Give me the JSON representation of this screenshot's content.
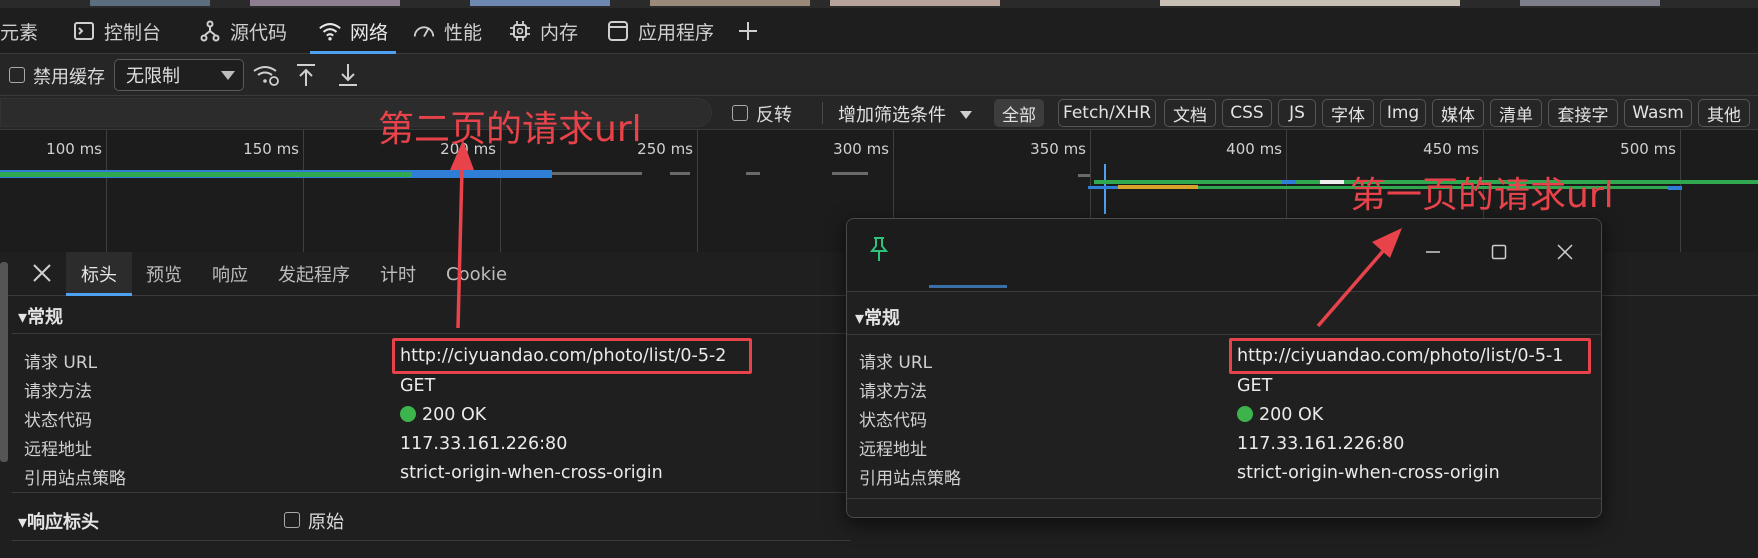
{
  "main_tabs": [
    {
      "label": "元素",
      "icon": "elements-icon"
    },
    {
      "label": "控制台",
      "icon": "console-icon"
    },
    {
      "label": "源代码",
      "icon": "sources-icon"
    },
    {
      "label": "网络",
      "icon": "wifi-icon",
      "active": true
    },
    {
      "label": "性能",
      "icon": "performance-icon"
    },
    {
      "label": "内存",
      "icon": "memory-chip-icon"
    },
    {
      "label": "应用程序",
      "icon": "application-icon"
    }
  ],
  "toolbar": {
    "disable_cache_label": "禁用缓存",
    "throttle_value": "无限制"
  },
  "filter": {
    "invert_label": "反转",
    "more_filters_label": "增加筛选条件",
    "types": [
      "全部",
      "Fetch/XHR",
      "文档",
      "CSS",
      "JS",
      "字体",
      "Img",
      "媒体",
      "清单",
      "套接字",
      "Wasm",
      "其他"
    ]
  },
  "timeline": {
    "ticks": [
      "100 ms",
      "150 ms",
      "200 ms",
      "250 ms",
      "300 ms",
      "350 ms",
      "400 ms",
      "450 ms",
      "500 ms"
    ]
  },
  "detail_tabs": [
    "标头",
    "预览",
    "响应",
    "发起程序",
    "计时",
    "Cookie"
  ],
  "general": {
    "title": "常规",
    "labels": [
      "请求 URL",
      "请求方法",
      "状态代码",
      "远程地址",
      "引用站点策略"
    ],
    "left": {
      "url": "http://ciyuandao.com/photo/list/0-5-2",
      "method": "GET",
      "status": "200 OK",
      "remote": "117.33.161.226:80",
      "referrer_policy": "strict-origin-when-cross-origin"
    },
    "right": {
      "url": "http://ciyuandao.com/photo/list/0-5-1",
      "method": "GET",
      "status": "200 OK",
      "remote": "117.33.161.226:80",
      "referrer_policy": "strict-origin-when-cross-origin"
    }
  },
  "response_headers": {
    "title": "响应标头",
    "raw_label": "原始"
  },
  "annotations": {
    "second_page": "第二页的请求url",
    "first_page": "第一页的请求url"
  },
  "colors": {
    "accent": "#4ea1f3",
    "annotation_red": "#e8434a",
    "status_green": "#3cb44b",
    "timeline_green": "#2fa84f",
    "timeline_blue": "#2f7fd6",
    "pin_green": "#2fc27a"
  }
}
